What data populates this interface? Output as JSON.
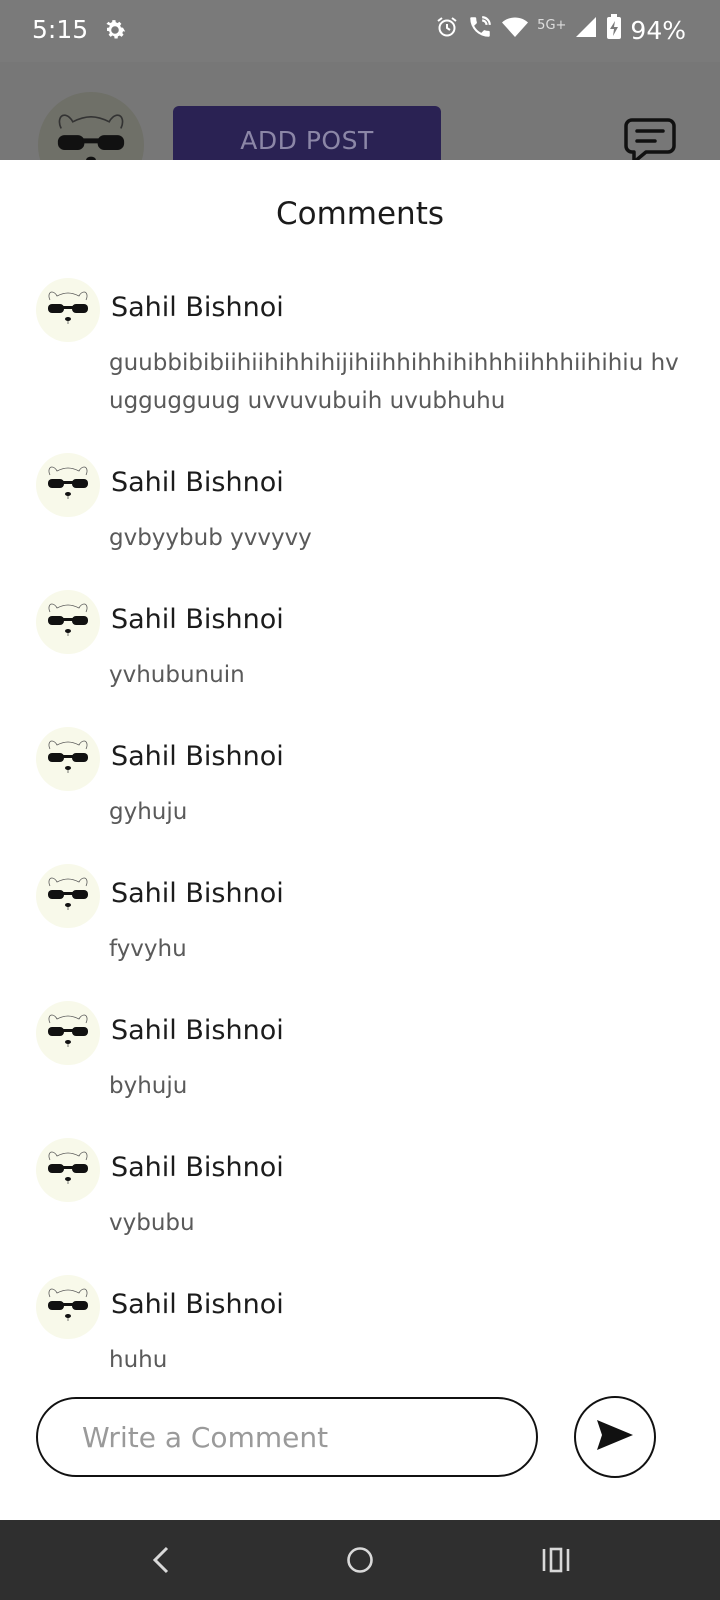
{
  "status_bar": {
    "time": "5:15",
    "network": "5G+",
    "battery": "94%",
    "icons": [
      "gear-icon",
      "alarm-icon",
      "wifi-calling-icon",
      "wifi-icon",
      "signal-icon",
      "battery-charging-icon"
    ]
  },
  "background_app": {
    "add_post_label": "ADD POST",
    "icons": [
      "avatar",
      "chat-icon"
    ]
  },
  "sheet": {
    "title": "Comments"
  },
  "comments": [
    {
      "name": "Sahil Bishnoi",
      "text": "guubbibibiihiihihhihijihiihhihhihihhhiihhhiihihiu hvuggugguug uvvuvubuih uvubhuhu"
    },
    {
      "name": "Sahil Bishnoi",
      "text": "gvbyybub yvvyvy"
    },
    {
      "name": "Sahil Bishnoi",
      "text": "yvhubunuin"
    },
    {
      "name": "Sahil Bishnoi",
      "text": "gyhuju"
    },
    {
      "name": "Sahil Bishnoi",
      "text": "fyvyhu"
    },
    {
      "name": "Sahil Bishnoi",
      "text": "byhuju"
    },
    {
      "name": "Sahil Bishnoi",
      "text": "vybubu"
    },
    {
      "name": "Sahil Bishnoi",
      "text": "huhu"
    }
  ],
  "comment_input": {
    "placeholder": "Write a Comment",
    "value": ""
  },
  "send_button": {
    "icon": "send-icon"
  },
  "nav_bar": {
    "icons": [
      "back-icon",
      "home-icon",
      "recents-icon"
    ]
  },
  "colors": {
    "overlay_gray": "#777777",
    "add_post_bg": "#2a2253",
    "nav_bar": "#2f2f2f",
    "avatar_bg": "#f8f9ea"
  }
}
